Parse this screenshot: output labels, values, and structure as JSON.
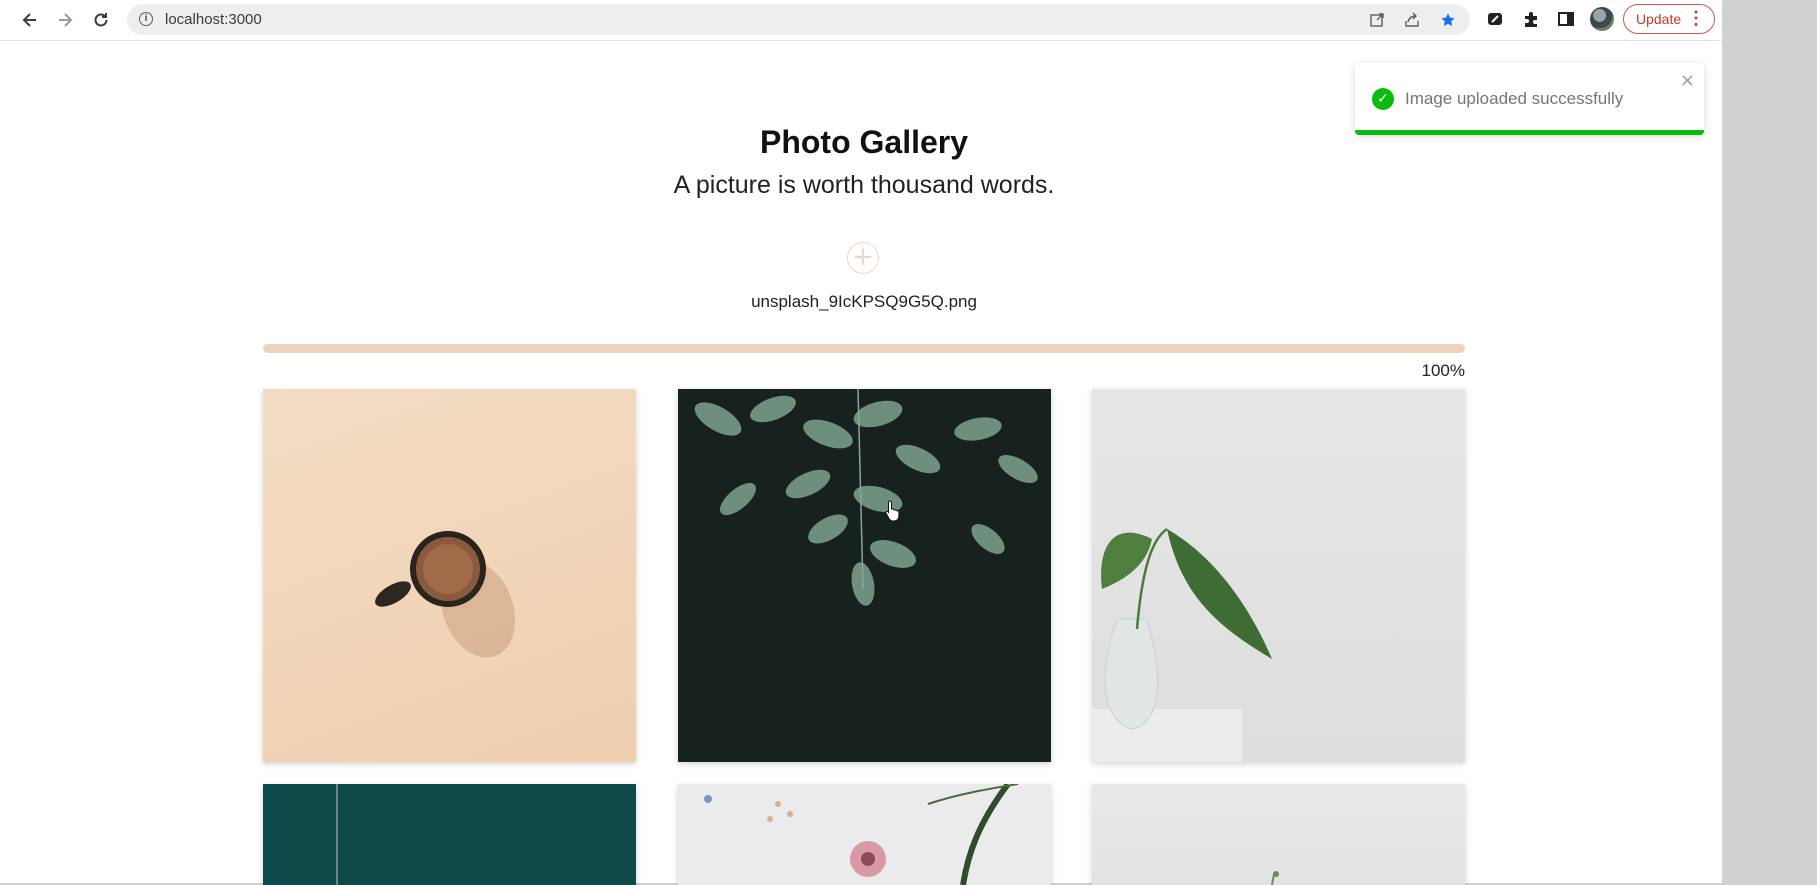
{
  "browser": {
    "url": "localhost:3000",
    "update_label": "Update"
  },
  "page": {
    "title": "Photo Gallery",
    "subtitle": "A picture is worth thousand words.",
    "upload_symbol": "+",
    "uploaded_filename": "unsplash_9IcKPSQ9G5Q.png",
    "progress_percent": 100,
    "progress_label": "100%"
  },
  "toast": {
    "message": "Image uploaded successfully",
    "status_color": "#07bc0c",
    "close_symbol": "×"
  },
  "gallery": {
    "images": [
      {
        "subject": "coffee cup on beige background"
      },
      {
        "subject": "green leaves on dark background"
      },
      {
        "subject": "plant leaf in glass vase"
      },
      {
        "subject": "teal background with thin stem"
      },
      {
        "subject": "dried flowers on white"
      },
      {
        "subject": "light grey background with plant"
      }
    ]
  },
  "colors": {
    "progress": "#efd3bd",
    "accent_star": "#1a73e8",
    "update_border": "#d9534f"
  }
}
